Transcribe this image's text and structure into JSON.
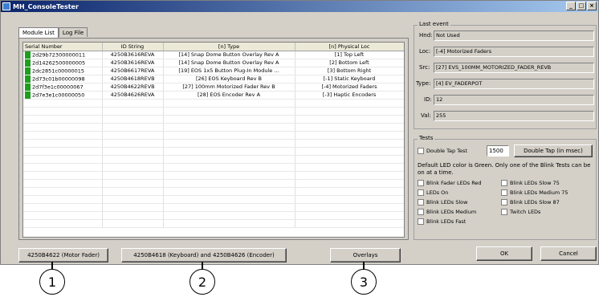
{
  "window": {
    "title": "MH_ConsoleTester",
    "min": "_",
    "max": "□",
    "close": "×"
  },
  "tabs": [
    {
      "label": "Module List"
    },
    {
      "label": "Log File"
    }
  ],
  "table": {
    "headers": [
      "Serial Number",
      "ID String",
      "[n] Type",
      "[n] Physical Loc"
    ],
    "rows": [
      [
        "2d29b72300000011",
        "4250B3616REVA",
        "[14] Snap Dome Button Overlay Rev A",
        "[1] Top Left"
      ],
      [
        "2d14262500000005",
        "4250B3616REVA",
        "[14] Snap Dome Button Overlay Rev A",
        "[2] Bottom Left"
      ],
      [
        "2dc2851c00000015",
        "4250B6617REVA",
        "[19] EOS 1x5 Button Plug-In Module ...",
        "[3] Bottom Right"
      ],
      [
        "2d73c01b00000098",
        "4250B4618REVB",
        "[26] EOS Keyboard Rev B",
        "[-1] Static Keyboard"
      ],
      [
        "2d7f3e1c00000067",
        "4250B4622REVB",
        "[27] 100mm Motorized Fader Rev B",
        "[-4] Motorized Faders"
      ],
      [
        "2d7e3e1c00000050",
        "4250B4626REVA",
        "[28] EOS Encoder Rev A",
        "[-3] Haptic Encoders"
      ]
    ],
    "led_color": "#1e9e1e"
  },
  "buttons": {
    "motor_fader": "4250B4622 (Motor Fader)",
    "keyboard_encoder": "4250B4618 (Keyboard) and 4250B4626 (Encoder)",
    "overlays": "Overlays",
    "ok": "OK",
    "cancel": "Cancel"
  },
  "last_event": {
    "group_title": "Last event",
    "hnd_label": "Hnd:",
    "hnd_value": "Not Used",
    "loc_label": "Loc:",
    "loc_value": "[-4] Motorized Faders",
    "src_label": "Src:",
    "src_value": "[27] EVS_100MM_MOTORIZED_FADER_REVB",
    "type_label": "Type:",
    "type_value": "[4] EV_FADERPOT",
    "id_label": "ID:",
    "id_value": "12",
    "val_label": "Val:",
    "val_value": "255"
  },
  "tests": {
    "group_title": "Tests",
    "double_tap_label": "Double Tap Test",
    "double_tap_value": "1500",
    "double_tap_button": "Double Tap (in msec)",
    "note": "Default LED color is Green. Only one of the Blink Tests can be on at a time.",
    "checks_left": [
      "Blink Fader LEDs Red",
      "LEDs On",
      "Blink LEDs Slow",
      "Blink LEDs Medium",
      "Blink LEDs Fast"
    ],
    "checks_right": [
      "Blink LEDs Slow 75",
      "Blink LEDs Medium 75",
      "Blink LEDs Slow 87",
      "Twitch LEDs"
    ]
  },
  "callouts": [
    "1",
    "2",
    "3"
  ]
}
